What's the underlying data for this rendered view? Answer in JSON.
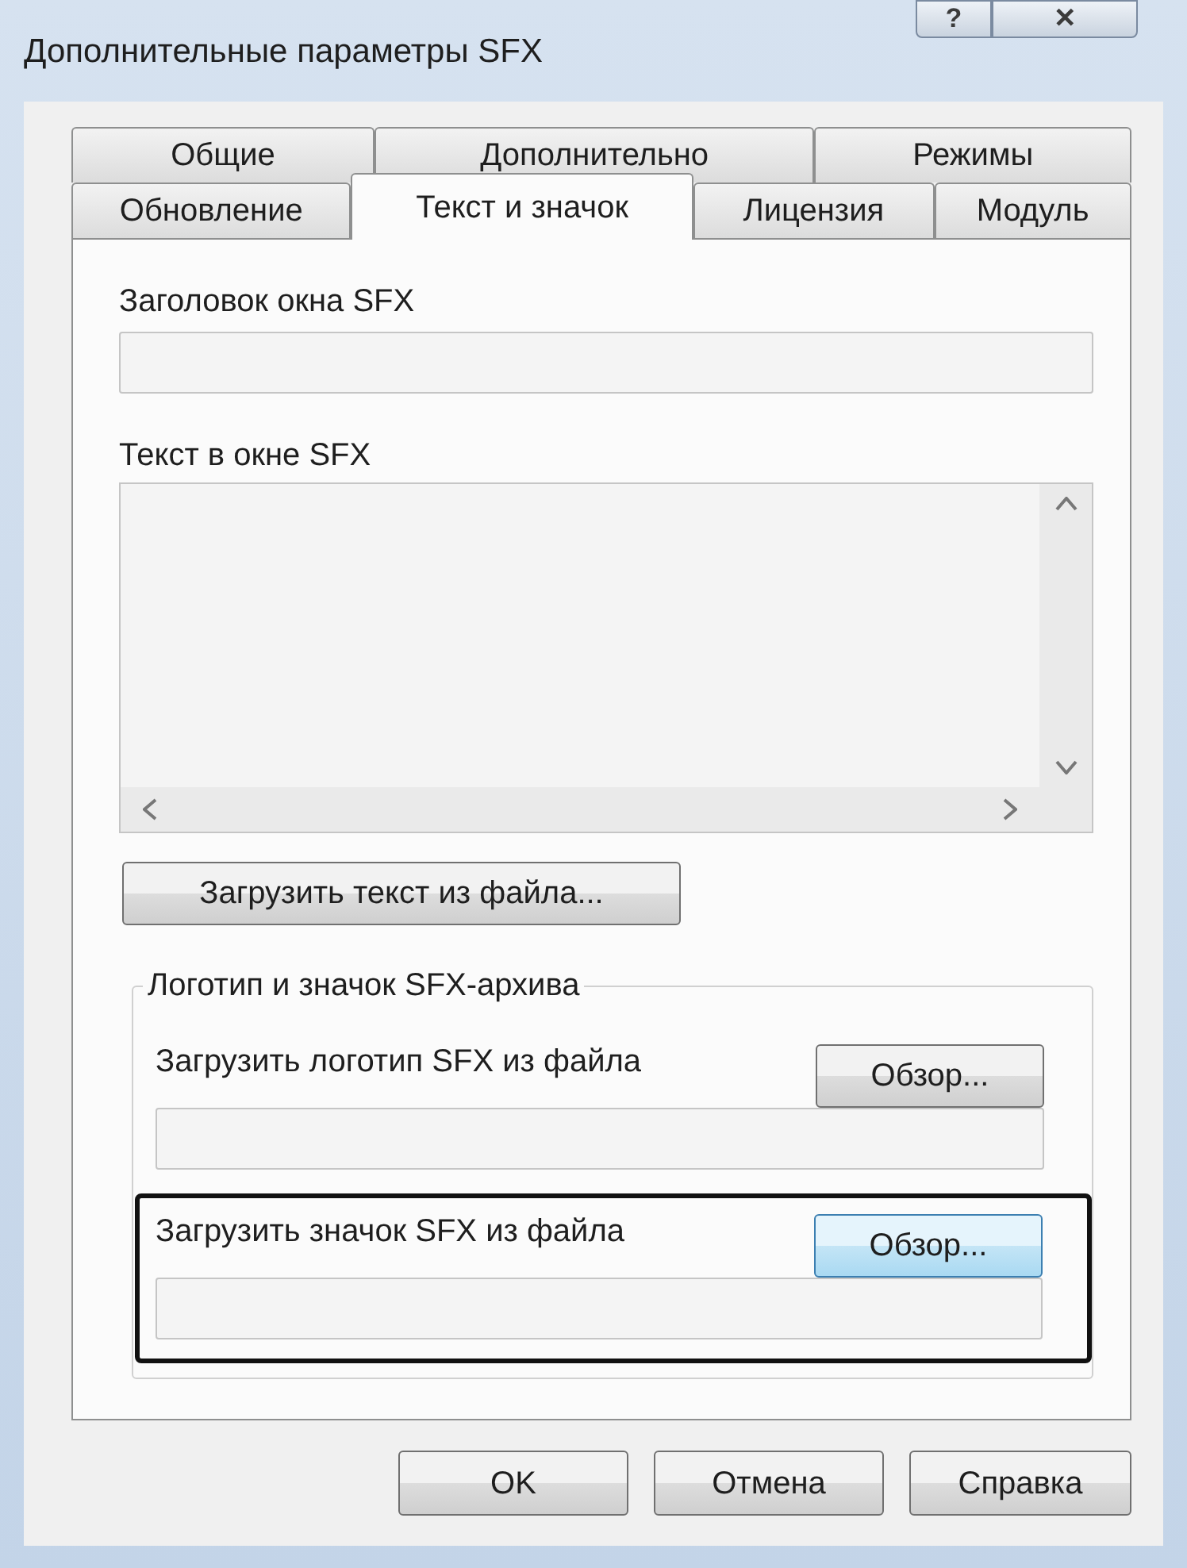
{
  "window": {
    "title": "Дополнительные параметры SFX",
    "help_button": "?",
    "close_button": "✕"
  },
  "tab_rows": [
    [
      {
        "label": "Общие",
        "selected": false
      },
      {
        "label": "Дополнительно",
        "selected": false
      },
      {
        "label": "Режимы",
        "selected": false
      }
    ],
    [
      {
        "label": "Обновление",
        "selected": false
      },
      {
        "label": "Текст и значок",
        "selected": true
      },
      {
        "label": "Лицензия",
        "selected": false
      },
      {
        "label": "Модуль",
        "selected": false
      }
    ]
  ],
  "title_field": {
    "label": "Заголовок окна SFX"
  },
  "text_area": {
    "label": "Текст в окне SFX"
  },
  "load_text_button": "Загрузить текст из файла...",
  "group": {
    "legend": "Логотип и значок SFX-архива",
    "items": [
      {
        "label": "Загрузить логотип SFX из файла",
        "button": "Обзор...",
        "focused": false,
        "highlighted": false
      },
      {
        "label": "Загрузить значок SFX из файла",
        "button": "Обзор...",
        "focused": true,
        "highlighted": true
      }
    ]
  },
  "buttons": [
    "OK",
    "Отмена",
    "Справка"
  ]
}
